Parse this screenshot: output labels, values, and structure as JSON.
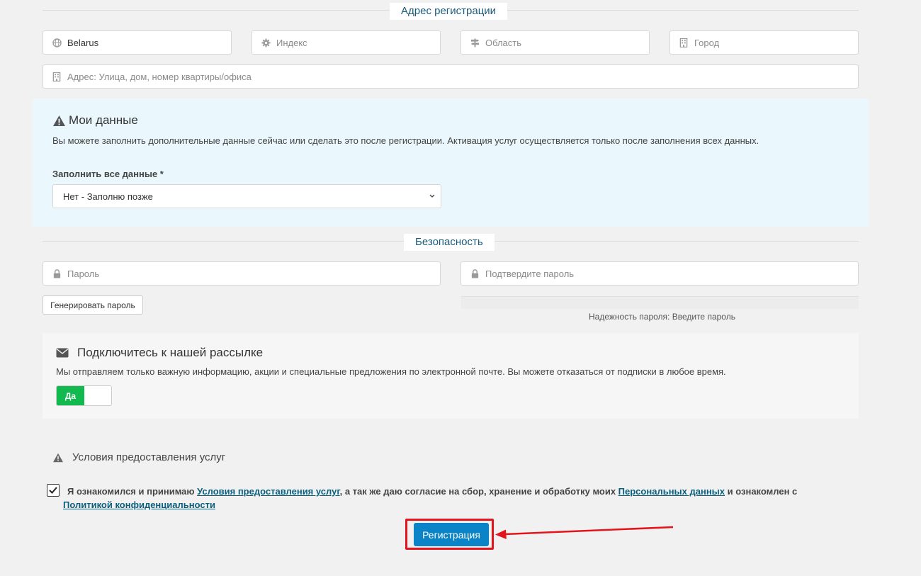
{
  "address_section": {
    "title": "Адрес регистрации",
    "country_value": "Belarus",
    "postcode_placeholder": "Индекс",
    "region_placeholder": "Область",
    "city_placeholder": "Город",
    "address_placeholder": "Адрес: Улица, дом, номер квартиры/офиса"
  },
  "my_data": {
    "title": "Мои данные",
    "description": "Вы можете заполнить дополнительные данные сейчас или сделать это после регистрации. Активация услуг осуществляется только после заполнения всех данных.",
    "select_label": "Заполнить все данные *",
    "select_value": "Нет - Заполню позже"
  },
  "security_section": {
    "title": "Безопасность",
    "password_placeholder": "Пароль",
    "confirm_placeholder": "Подтвердите пароль",
    "generate_button": "Генерировать пароль",
    "strength_text": "Надежность пароля: Введите пароль"
  },
  "newsletter": {
    "title": "Подключитесь к нашей рассылке",
    "description": "Мы отправляем только важную информацию, акции и специальные предложения по электронной почте. Вы можете отказаться от подписки в любое время.",
    "toggle_on_label": "Да"
  },
  "terms": {
    "title": "Условия предоставления услуг",
    "text_part1": "Я ознакомился и принимаю ",
    "link_terms": "Условия предоставления услуг",
    "text_part2": ", а так же даю согласие на сбор, хранение и обработку моих ",
    "link_personal": "Персональных данных",
    "text_part3": " и ознакомлен с ",
    "link_privacy": "Политикой конфиденциальности",
    "checked": true
  },
  "register_button": "Регистрация",
  "colors": {
    "primary_button": "#0a84c6",
    "toggle_on": "#12b94f",
    "annotation_red": "#e3141b",
    "info_panel": "#eaf7fd",
    "section_title": "#1a5a7a"
  }
}
